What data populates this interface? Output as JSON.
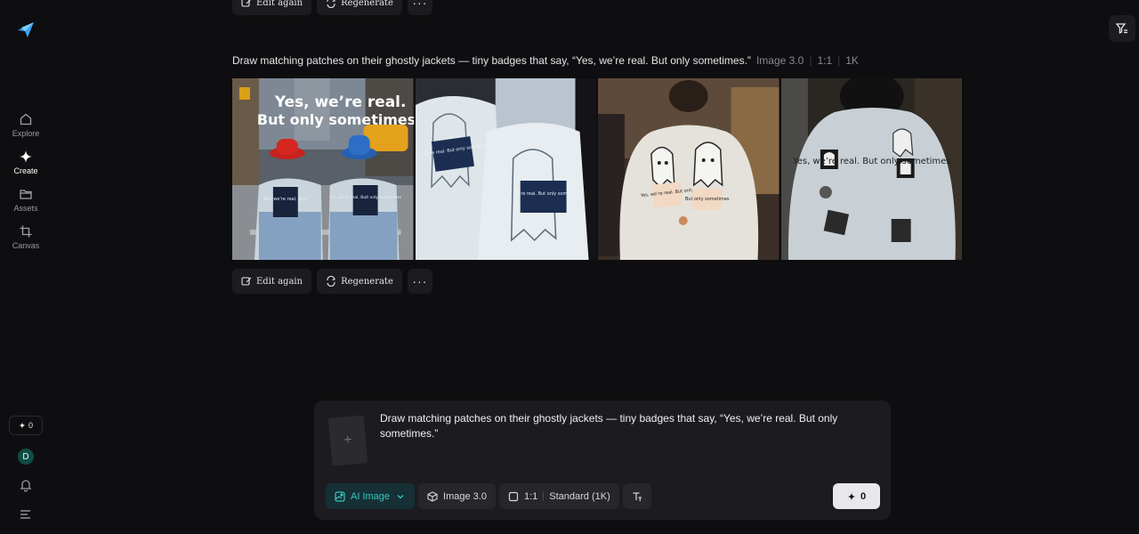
{
  "sidebar": {
    "nav": [
      {
        "label": "Explore",
        "icon": "home-icon"
      },
      {
        "label": "Create",
        "icon": "sparkle-icon"
      },
      {
        "label": "Assets",
        "icon": "folder-icon"
      },
      {
        "label": "Canvas",
        "icon": "crop-icon"
      }
    ],
    "credits": "0",
    "avatar_initial": "D"
  },
  "actions": {
    "edit_again": "Edit again",
    "regenerate": "Regenerate",
    "more": "···"
  },
  "result": {
    "prompt": "Draw matching patches on their ghostly jackets — tiny badges that say, “Yes, we’re real. But only sometimes.”",
    "model": "Image 3.0",
    "ratio": "1:1",
    "resolution": "1K",
    "images": [
      {
        "overlay_text_1": "Yes, we’re real.",
        "overlay_text_2": "But only sometimes",
        "patch_1": "Yes, we’re real, only",
        "patch_2": "Yes, we’re real. Bult only sometimes"
      },
      {
        "patch_1": "Yes, we’re real. But only sometimes.",
        "patch_2": "Yes, we’re real. But only sometimes."
      },
      {
        "patch_1": "Yes, we’re real. But only",
        "patch_2": "But only sometimes"
      },
      {
        "patch_1": "Yes, we’re real. But only sometimes"
      }
    ]
  },
  "composer": {
    "text": "Draw matching patches on their ghostly jackets — tiny badges that say, “Yes, we’re real. But only sometimes.”",
    "mode": "AI Image",
    "model": "Image 3.0",
    "ratio": "1:1",
    "quality": "Standard (1K)",
    "generate_cost": "0"
  },
  "colors": {
    "background": "#0e0e10",
    "panel": "#1c1c20",
    "accent": "#35c7c1",
    "avatar": "#0f4c45"
  }
}
